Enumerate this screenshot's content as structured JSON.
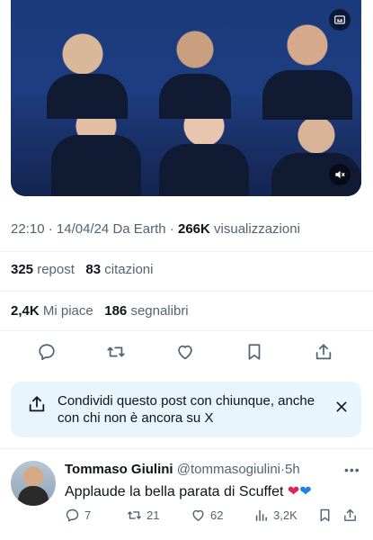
{
  "post": {
    "time": "22:10",
    "date": "14/04/24",
    "source": "Da Earth",
    "views_count": "266K",
    "views_label": "visualizzazioni",
    "reposts_count": "325",
    "reposts_label": "repost",
    "quotes_count": "83",
    "quotes_label": "citazioni",
    "likes_count": "2,4K",
    "likes_label": "Mi piace",
    "bookmarks_count": "186",
    "bookmarks_label": "segnalibri"
  },
  "share_prompt": {
    "text": "Condividi questo post con chiunque, anche con chi non è ancora su X"
  },
  "reply": {
    "name": "Tommaso Giulini",
    "handle": "@tommasogiulini",
    "age": "5h",
    "text": "Applaude la bella parata di Scuffet",
    "replies": "7",
    "reposts": "21",
    "likes": "62",
    "views": "3,2K"
  },
  "icons": {
    "video": [
      "captions-icon",
      "mute-icon"
    ],
    "actions": [
      "reply-icon",
      "repost-icon",
      "like-icon",
      "bookmark-icon",
      "share-icon"
    ],
    "reply_emojis": [
      "red-heart",
      "blue-heart"
    ]
  },
  "colors": {
    "accent": "#1d9bf0",
    "share_bg": "#e8f5fd",
    "muted": "#536471"
  }
}
